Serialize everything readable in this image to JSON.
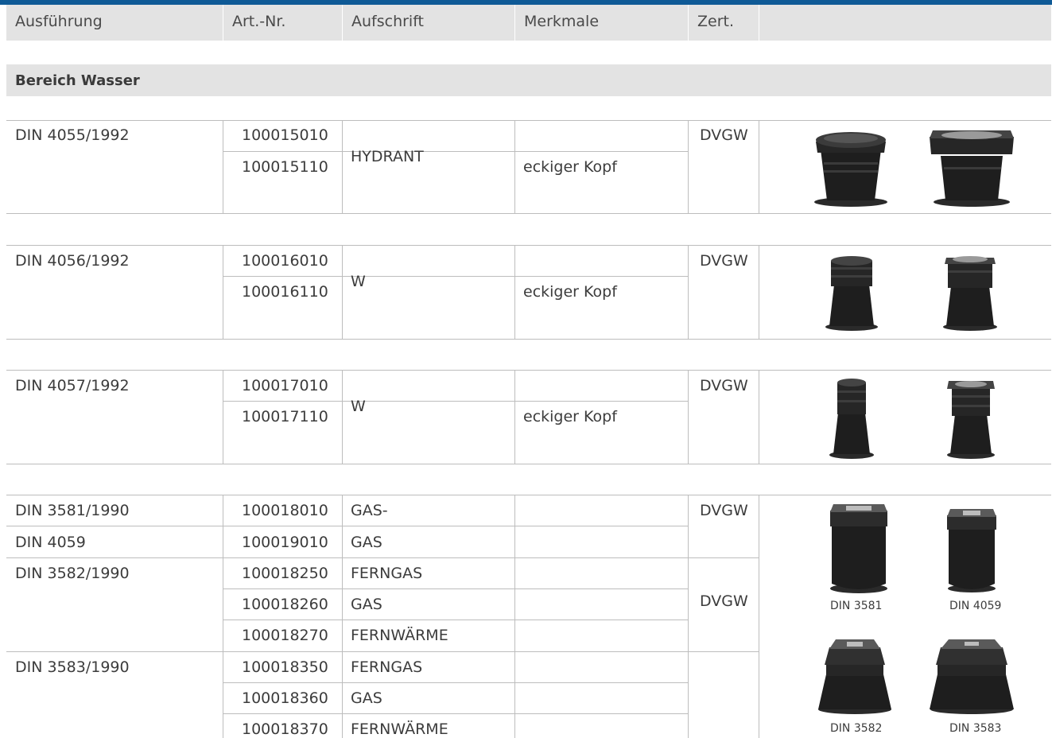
{
  "header": {
    "columns": [
      "Ausführung",
      "Art.-Nr.",
      "Aufschrift",
      "Merkmale",
      "Zert.",
      ""
    ]
  },
  "section": {
    "title": "Bereich Wasser"
  },
  "groups": [
    {
      "ausfuehrung": "DIN 4055/1992",
      "rows": [
        {
          "art_nr": "100015010",
          "merkmale": "",
          "zert": "DVGW"
        },
        {
          "art_nr": "100015110",
          "merkmale": "eckiger Kopf",
          "zert": ""
        }
      ],
      "aufschrift": "HYDRANT",
      "images": [
        "round-hydrant-box",
        "square-head-hydrant-box"
      ]
    },
    {
      "ausfuehrung": "DIN 4056/1992",
      "rows": [
        {
          "art_nr": "100016010",
          "merkmale": "",
          "zert": "DVGW"
        },
        {
          "art_nr": "100016110",
          "merkmale": "eckiger Kopf",
          "zert": ""
        }
      ],
      "aufschrift": "W",
      "images": [
        "round-valve-box",
        "square-head-valve-box"
      ]
    },
    {
      "ausfuehrung": "DIN 4057/1992",
      "rows": [
        {
          "art_nr": "100017010",
          "merkmale": "",
          "zert": "DVGW"
        },
        {
          "art_nr": "100017110",
          "merkmale": "eckiger Kopf",
          "zert": ""
        }
      ],
      "aufschrift": "W",
      "images": [
        "round-valve-box-small",
        "square-head-valve-box-small"
      ]
    }
  ],
  "gas_group": {
    "rows": [
      {
        "ausfuehrung": "DIN 3581/1990",
        "art_nr": "100018010",
        "aufschrift": "GAS-",
        "merkmale": "",
        "zert": "DVGW"
      },
      {
        "ausfuehrung": "DIN 4059",
        "art_nr": "100019010",
        "aufschrift": "GAS",
        "merkmale": "",
        "zert": ""
      },
      {
        "ausfuehrung": "DIN 3582/1990",
        "art_nr": "100018250",
        "aufschrift": "FERNGAS",
        "merkmale": "",
        "zert": "DVGW"
      },
      {
        "ausfuehrung": "",
        "art_nr": "100018260",
        "aufschrift": "GAS",
        "merkmale": "",
        "zert": ""
      },
      {
        "ausfuehrung": "",
        "art_nr": "100018270",
        "aufschrift": "FERNWÄRME",
        "merkmale": "",
        "zert": ""
      },
      {
        "ausfuehrung": "DIN 3583/1990",
        "art_nr": "100018350",
        "aufschrift": "FERNGAS",
        "merkmale": "",
        "zert": ""
      },
      {
        "ausfuehrung": "",
        "art_nr": "100018360",
        "aufschrift": "GAS",
        "merkmale": "",
        "zert": ""
      },
      {
        "ausfuehrung": "",
        "art_nr": "100018370",
        "aufschrift": "FERNWÄRME",
        "merkmale": "",
        "zert": ""
      }
    ],
    "image_captions": [
      "DIN 3581",
      "DIN 4059",
      "DIN 3582",
      "DIN 3583"
    ]
  }
}
